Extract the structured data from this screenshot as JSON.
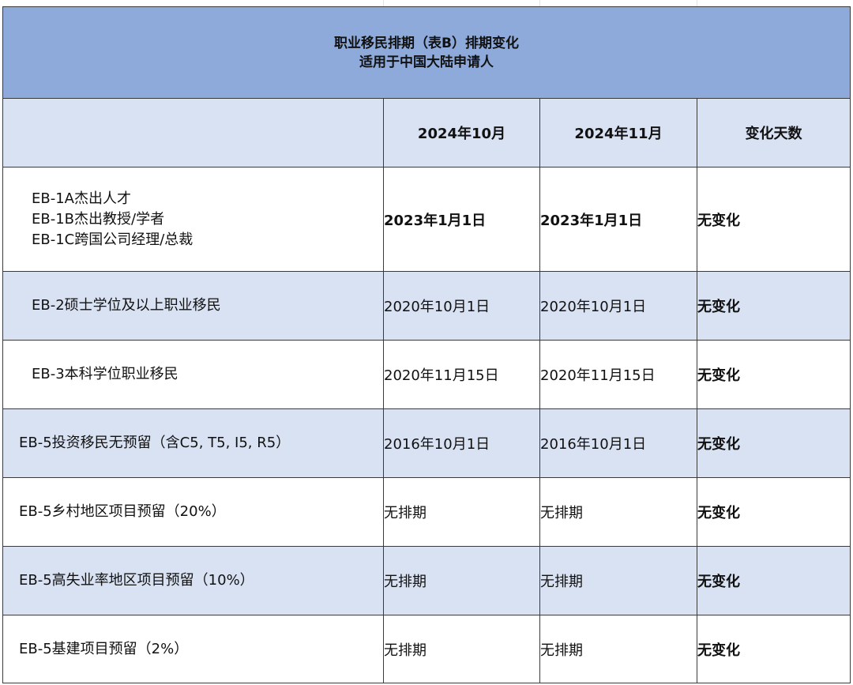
{
  "title": {
    "line1": "职业移民排期（表B）排期变化",
    "line2": "适用于中国大陆申请人"
  },
  "columns": [
    "",
    "2024年10月",
    "2024年11月",
    "变化天数"
  ],
  "rows": [
    {
      "category": [
        "EB-1A杰出人才",
        "EB-1B杰出教授/学者",
        "EB-1C跨国公司经理/总裁"
      ],
      "oct": "2023年1月1日",
      "nov": "2023年1月1日",
      "change": "无变化"
    },
    {
      "category": [
        "EB-2硕士学位及以上职业移民"
      ],
      "oct": "2020年10月1日",
      "nov": "2020年10月1日",
      "change": "无变化"
    },
    {
      "category": [
        "EB-3本科学位职业移民"
      ],
      "oct": "2020年11月15日",
      "nov": "2020年11月15日",
      "change": "无变化"
    },
    {
      "category": [
        "EB-5投资移民无预留（含C5, T5, I5, R5）"
      ],
      "oct": "2016年10月1日",
      "nov": "2016年10月1日",
      "change": "无变化"
    },
    {
      "category": [
        "EB-5乡村地区项目预留（20%）"
      ],
      "oct": "无排期",
      "nov": "无排期",
      "change": "无变化"
    },
    {
      "category": [
        "EB-5高失业率地区项目预留（10%）"
      ],
      "oct": "无排期",
      "nov": "无排期",
      "change": "无变化"
    },
    {
      "category": [
        "EB-5基建项目预留（2%）"
      ],
      "oct": "无排期",
      "nov": "无排期",
      "change": "无变化"
    }
  ],
  "colors": {
    "title_bg": "#8eaadb",
    "band_bg": "#d9e2f3",
    "border": "#3a3a3a"
  }
}
